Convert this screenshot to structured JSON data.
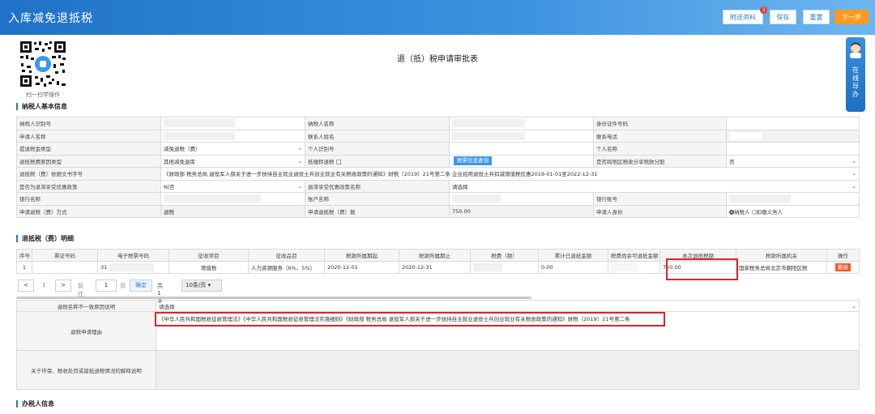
{
  "header": {
    "title": "入库减免退抵税",
    "buttons": {
      "attach": "附送资料",
      "attach_badge": "3",
      "save": "保存",
      "reset": "重置",
      "next": "下一步"
    }
  },
  "qr": {
    "caption": "扫一扫学操作"
  },
  "page_title": "退（抵）税申请审批表",
  "helper": {
    "text": "在线导办"
  },
  "sections": {
    "basic": "纳税人基本信息",
    "detail": "退抵税（费）明细",
    "handler": "办税人信息"
  },
  "basic_info": {
    "row1": {
      "l1": "纳税人识别号",
      "l2": "纳税人名称",
      "l3": "身份证件号码"
    },
    "row2": {
      "l1": "申请人名称",
      "l2": "联系人姓名",
      "l3": "联系电话"
    },
    "row3": {
      "l1": "提退税金类型",
      "v1": "减免退税（费）",
      "l2": "个人识别号",
      "l3": "个人名称"
    },
    "row4": {
      "l1": "退抵税费原因类型",
      "v1": "其他减免退库",
      "l2": "抵缴转退税",
      "btn": "税票信息查询",
      "l3": "是否跨地区税收分享税款分配",
      "v3": "否"
    },
    "row5": {
      "l1": "退抵税（费）依据文书字号",
      "v1": "《财政部 税务总局 退役军人部关于进一步扶持自主就业退役士兵创业就业有关税收政策的通知》财税〔2019〕21号第二条 企业招用退役士兵扣减增值税优惠2019-01-01至2022-12-31"
    },
    "row6": {
      "l1": "是否为退滞享受优惠政策",
      "v1": "N|否",
      "l2": "退滞享受优惠政策名称",
      "v2": "请选择"
    },
    "row7": {
      "l1": "银行名称",
      "l2": "账户名称",
      "l3": "银行账号"
    },
    "row8": {
      "l1": "申请退税（费）方式",
      "v1": "退税",
      "l2": "申请退抵税（费）额",
      "v2": "750.00",
      "l3": "申请人身份",
      "opt1": "纳税人",
      "opt2": "扣缴义务人"
    }
  },
  "detail_table": {
    "headers": [
      "序号",
      "票证号码",
      "电子税票号码",
      "征收项目",
      "征收品目",
      "税款所属期起",
      "税款所属期止",
      "税费（额）",
      "累计已退抵金额",
      "税费尚余可退抵金额",
      "本次退抵税额",
      "税款所属机关",
      "操作"
    ],
    "row": {
      "index": "1",
      "ticket_prefix": "31",
      "item": "增值税",
      "subitem": "人力资源服务（6%、5%）",
      "start": "2020-12-01",
      "end": "2020-12-31",
      "refunded": "0.00",
      "amount": "750.00",
      "authority": "国家税务总局北京市朝阳区税",
      "delete": "删除"
    }
  },
  "pager": {
    "prev": "<",
    "page_num": "1",
    "next": ">",
    "goto": "前往",
    "page_input": "1",
    "page_unit": "页",
    "confirm": "确定",
    "total": "共1条",
    "per_page": "10条/页"
  },
  "reason": {
    "mismatch_label": "退税名称不一致原因说明",
    "mismatch_value": "请选择",
    "reason_label": "退税申请理由",
    "reason_value": "《中华人民共和国税收征收管理法》《中华人民共和国税收征收管理法实施细则》《财政部 税务总局 退役军人部关于进一步扶持自主就业退役士兵创业就业有关税收政策的通知》财税〔2019〕21号第二条",
    "env_label": "关于环保、税收处罚或留抵退税情况的解释说明"
  },
  "colors": {
    "primary": "#2b76c9",
    "accent": "#ff9a1f",
    "highlight": "#d9262b",
    "button": "#3e97e5"
  }
}
